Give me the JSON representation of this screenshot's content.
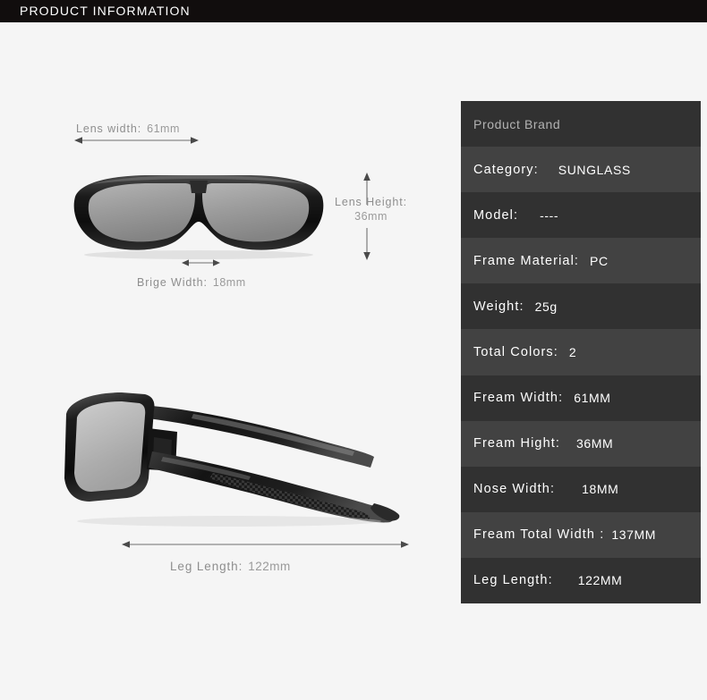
{
  "header": {
    "title": "PRODUCT INFORMATION"
  },
  "diagram": {
    "front_view_alt": "sunglasses-front-view",
    "side_view_alt": "sunglasses-side-view",
    "annotations": [
      {
        "name": "lens-width",
        "label": "Lens width:",
        "value": "61mm"
      },
      {
        "name": "lens-height",
        "label": "Lens Height:",
        "value": "36mm"
      },
      {
        "name": "bridge-width",
        "label": "Brige Width:",
        "value": "18mm"
      },
      {
        "name": "leg-length",
        "label": "Leg Length:",
        "value": "122mm"
      }
    ]
  },
  "spec_table": {
    "rows": [
      {
        "label": "Product Brand",
        "value": ""
      },
      {
        "label": "Category:",
        "value": "SUNGLASS"
      },
      {
        "label": "Model:",
        "value": "----"
      },
      {
        "label": "Frame Material:",
        "value": "PC"
      },
      {
        "label": "Weight:",
        "value": "25g"
      },
      {
        "label": "Total Colors:",
        "value": "2"
      },
      {
        "label": "Fream Width:",
        "value": "61MM"
      },
      {
        "label": "Fream Hight:",
        "value": "36MM"
      },
      {
        "label": "Nose Width:",
        "value": "18MM"
      },
      {
        "label": "Fream Total Width :",
        "value": "137MM"
      },
      {
        "label": "Leg Length:",
        "value": "122MM"
      }
    ]
  },
  "colors": {
    "page_background": "#f5f5f5",
    "header_background": "#110d0d",
    "row_dark": "#313131",
    "row_light": "#424242",
    "annotation_text": "#8e8e8e"
  }
}
